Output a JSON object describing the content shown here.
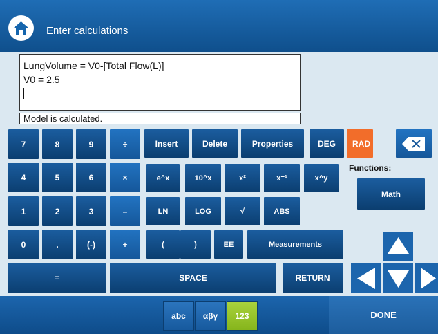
{
  "header": {
    "title": "Enter calculations",
    "home_icon": "home-icon"
  },
  "editor": {
    "lines": [
      "LungVolume = V0-[Total Flow(L)]",
      "V0 = 2.5"
    ],
    "status": "Model is calculated."
  },
  "keypad": {
    "num_row1": [
      "7",
      "8",
      "9",
      "÷"
    ],
    "num_row2": [
      "4",
      "5",
      "6",
      "×"
    ],
    "num_row3": [
      "1",
      "2",
      "3",
      "–"
    ],
    "num_row4": [
      "0",
      ".",
      "(-)",
      "+"
    ],
    "equals": "=",
    "space": "SPACE",
    "return": "RETURN",
    "insert": "Insert",
    "delete": "Delete",
    "properties": "Properties",
    "deg": "DEG",
    "rad": "RAD",
    "backspace_icon": "backspace-icon",
    "fn_row1": [
      "e^x",
      "10^x",
      "x²",
      "x⁻¹",
      "x^y"
    ],
    "fn_row2": [
      "LN",
      "LOG",
      "√",
      "ABS"
    ],
    "fn_row3": [
      "(",
      ")",
      "EE"
    ],
    "measurements": "Measurements",
    "functions_label": "Functions:",
    "math": "Math"
  },
  "bottom": {
    "modes": [
      "abc",
      "αβγ",
      "123"
    ],
    "active_mode": "123",
    "done": "DONE"
  },
  "colors": {
    "header": "#1565ad",
    "key": "#0f4a85",
    "rad_active": "#f26d2a",
    "mode_active": "#9ac72e",
    "background": "#dbe8f1"
  }
}
